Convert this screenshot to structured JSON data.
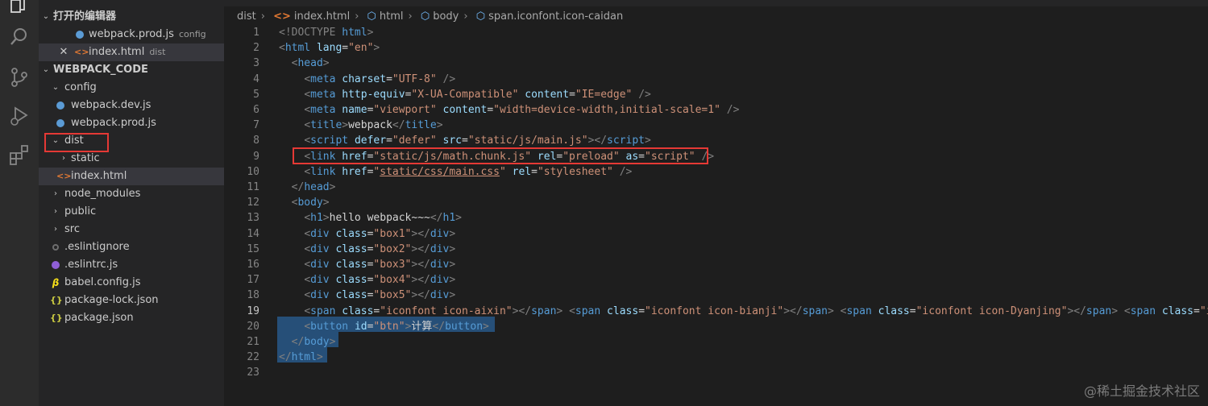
{
  "activity": {
    "icons": [
      "explorer-icon",
      "search-icon",
      "source-control-icon",
      "run-debug-icon",
      "extensions-icon"
    ]
  },
  "sidebar": {
    "open_editors_title": "打开的编辑器",
    "open_editors": [
      {
        "name": "webpack.prod.js",
        "desc": "config"
      },
      {
        "name": "index.html",
        "desc": "dist",
        "close": "✕"
      }
    ],
    "workspace_title": "WEBPACK_CODE",
    "tree": {
      "config": "config",
      "dev": "webpack.dev.js",
      "prod": "webpack.prod.js",
      "dist": "dist",
      "static": "static",
      "index": "index.html",
      "node_modules": "node_modules",
      "public": "public",
      "src": "src",
      "eslintignore": ".eslintignore",
      "eslintrc": ".eslintrc.js",
      "babel": "babel.config.js",
      "pkglock": "package-lock.json",
      "pkg": "package.json"
    }
  },
  "breadcrumb": {
    "dist": "dist",
    "index": "index.html",
    "html": "html",
    "body": "body",
    "span": "span.iconfont.icon-caidan"
  },
  "editor": {
    "line_numbers": [
      "1",
      "2",
      "3",
      "4",
      "5",
      "6",
      "7",
      "8",
      "9",
      "10",
      "11",
      "12",
      "13",
      "14",
      "15",
      "16",
      "17",
      "18",
      "19",
      "20",
      "21",
      "22",
      "23"
    ],
    "lines": [
      [
        [
          "t-pun",
          "<!DOCTYPE "
        ],
        [
          "t-tag",
          "html"
        ],
        [
          "t-pun",
          ">"
        ]
      ],
      [
        [
          "t-pun",
          "<"
        ],
        [
          "t-tag",
          "html "
        ],
        [
          "t-attr",
          "lang"
        ],
        [
          "t-txt",
          "="
        ],
        [
          "t-str",
          "\"en\""
        ],
        [
          "t-pun",
          ">"
        ]
      ],
      [
        [
          "t-txt",
          "  "
        ],
        [
          "t-pun",
          "<"
        ],
        [
          "t-tag",
          "head"
        ],
        [
          "t-pun",
          ">"
        ]
      ],
      [
        [
          "t-txt",
          "    "
        ],
        [
          "t-pun",
          "<"
        ],
        [
          "t-tag",
          "meta "
        ],
        [
          "t-attr",
          "charset"
        ],
        [
          "t-txt",
          "="
        ],
        [
          "t-str",
          "\"UTF-8\""
        ],
        [
          "t-txt",
          " "
        ],
        [
          "t-pun",
          "/>"
        ]
      ],
      [
        [
          "t-txt",
          "    "
        ],
        [
          "t-pun",
          "<"
        ],
        [
          "t-tag",
          "meta "
        ],
        [
          "t-attr",
          "http-equiv"
        ],
        [
          "t-txt",
          "="
        ],
        [
          "t-str",
          "\"X-UA-Compatible\""
        ],
        [
          "t-txt",
          " "
        ],
        [
          "t-attr",
          "content"
        ],
        [
          "t-txt",
          "="
        ],
        [
          "t-str",
          "\"IE=edge\""
        ],
        [
          "t-txt",
          " "
        ],
        [
          "t-pun",
          "/>"
        ]
      ],
      [
        [
          "t-txt",
          "    "
        ],
        [
          "t-pun",
          "<"
        ],
        [
          "t-tag",
          "meta "
        ],
        [
          "t-attr",
          "name"
        ],
        [
          "t-txt",
          "="
        ],
        [
          "t-str",
          "\"viewport\""
        ],
        [
          "t-txt",
          " "
        ],
        [
          "t-attr",
          "content"
        ],
        [
          "t-txt",
          "="
        ],
        [
          "t-str",
          "\"width=device-width,initial-scale=1\""
        ],
        [
          "t-txt",
          " "
        ],
        [
          "t-pun",
          "/>"
        ]
      ],
      [
        [
          "t-txt",
          "    "
        ],
        [
          "t-pun",
          "<"
        ],
        [
          "t-tag",
          "title"
        ],
        [
          "t-pun",
          ">"
        ],
        [
          "t-txt",
          "webpack"
        ],
        [
          "t-pun",
          "</"
        ],
        [
          "t-tag",
          "title"
        ],
        [
          "t-pun",
          ">"
        ]
      ],
      [
        [
          "t-txt",
          "    "
        ],
        [
          "t-pun",
          "<"
        ],
        [
          "t-tag",
          "script "
        ],
        [
          "t-attr",
          "defer"
        ],
        [
          "t-txt",
          "="
        ],
        [
          "t-str",
          "\"defer\""
        ],
        [
          "t-txt",
          " "
        ],
        [
          "t-attr",
          "src"
        ],
        [
          "t-txt",
          "="
        ],
        [
          "t-str",
          "\"static/js/main.js\""
        ],
        [
          "t-pun",
          "></"
        ],
        [
          "t-tag",
          "script"
        ],
        [
          "t-pun",
          ">"
        ]
      ],
      [
        [
          "t-txt",
          "    "
        ],
        [
          "t-pun",
          "<"
        ],
        [
          "t-tag",
          "link "
        ],
        [
          "t-attr",
          "href"
        ],
        [
          "t-txt",
          "="
        ],
        [
          "t-str",
          "\"static/js/math.chunk.js\""
        ],
        [
          "t-txt",
          " "
        ],
        [
          "t-attr",
          "rel"
        ],
        [
          "t-txt",
          "="
        ],
        [
          "t-str",
          "\"preload\""
        ],
        [
          "t-txt",
          " "
        ],
        [
          "t-attr",
          "as"
        ],
        [
          "t-txt",
          "="
        ],
        [
          "t-str",
          "\"script\""
        ],
        [
          "t-txt",
          " "
        ],
        [
          "t-pun",
          "/>"
        ]
      ],
      [
        [
          "t-txt",
          "    "
        ],
        [
          "t-pun",
          "<"
        ],
        [
          "t-tag",
          "link "
        ],
        [
          "t-attr",
          "href"
        ],
        [
          "t-txt",
          "="
        ],
        [
          "t-str",
          "\""
        ],
        [
          "t-link",
          "static/css/main.css"
        ],
        [
          "t-str",
          "\""
        ],
        [
          "t-txt",
          " "
        ],
        [
          "t-attr",
          "rel"
        ],
        [
          "t-txt",
          "="
        ],
        [
          "t-str",
          "\"stylesheet\""
        ],
        [
          "t-txt",
          " "
        ],
        [
          "t-pun",
          "/>"
        ]
      ],
      [
        [
          "t-txt",
          "  "
        ],
        [
          "t-pun",
          "</"
        ],
        [
          "t-tag",
          "head"
        ],
        [
          "t-pun",
          ">"
        ]
      ],
      [
        [
          "t-txt",
          "  "
        ],
        [
          "t-pun",
          "<"
        ],
        [
          "t-tag",
          "body"
        ],
        [
          "t-pun",
          ">"
        ]
      ],
      [
        [
          "t-txt",
          "    "
        ],
        [
          "t-pun",
          "<"
        ],
        [
          "t-tag",
          "h1"
        ],
        [
          "t-pun",
          ">"
        ],
        [
          "t-txt",
          "hello webpack~~~"
        ],
        [
          "t-pun",
          "</"
        ],
        [
          "t-tag",
          "h1"
        ],
        [
          "t-pun",
          ">"
        ]
      ],
      [
        [
          "t-txt",
          "    "
        ],
        [
          "t-pun",
          "<"
        ],
        [
          "t-tag",
          "div "
        ],
        [
          "t-attr",
          "class"
        ],
        [
          "t-txt",
          "="
        ],
        [
          "t-str",
          "\"box1\""
        ],
        [
          "t-pun",
          "></"
        ],
        [
          "t-tag",
          "div"
        ],
        [
          "t-pun",
          ">"
        ]
      ],
      [
        [
          "t-txt",
          "    "
        ],
        [
          "t-pun",
          "<"
        ],
        [
          "t-tag",
          "div "
        ],
        [
          "t-attr",
          "class"
        ],
        [
          "t-txt",
          "="
        ],
        [
          "t-str",
          "\"box2\""
        ],
        [
          "t-pun",
          "></"
        ],
        [
          "t-tag",
          "div"
        ],
        [
          "t-pun",
          ">"
        ]
      ],
      [
        [
          "t-txt",
          "    "
        ],
        [
          "t-pun",
          "<"
        ],
        [
          "t-tag",
          "div "
        ],
        [
          "t-attr",
          "class"
        ],
        [
          "t-txt",
          "="
        ],
        [
          "t-str",
          "\"box3\""
        ],
        [
          "t-pun",
          "></"
        ],
        [
          "t-tag",
          "div"
        ],
        [
          "t-pun",
          ">"
        ]
      ],
      [
        [
          "t-txt",
          "    "
        ],
        [
          "t-pun",
          "<"
        ],
        [
          "t-tag",
          "div "
        ],
        [
          "t-attr",
          "class"
        ],
        [
          "t-txt",
          "="
        ],
        [
          "t-str",
          "\"box4\""
        ],
        [
          "t-pun",
          "></"
        ],
        [
          "t-tag",
          "div"
        ],
        [
          "t-pun",
          ">"
        ]
      ],
      [
        [
          "t-txt",
          "    "
        ],
        [
          "t-pun",
          "<"
        ],
        [
          "t-tag",
          "div "
        ],
        [
          "t-attr",
          "class"
        ],
        [
          "t-txt",
          "="
        ],
        [
          "t-str",
          "\"box5\""
        ],
        [
          "t-pun",
          "></"
        ],
        [
          "t-tag",
          "div"
        ],
        [
          "t-pun",
          ">"
        ]
      ],
      [
        [
          "t-txt",
          "    "
        ],
        [
          "t-pun",
          "<"
        ],
        [
          "t-tag",
          "span "
        ],
        [
          "t-attr",
          "class"
        ],
        [
          "t-txt",
          "="
        ],
        [
          "t-str",
          "\"iconfont icon-aixin\""
        ],
        [
          "t-pun",
          "></"
        ],
        [
          "t-tag",
          "span"
        ],
        [
          "t-pun",
          ">"
        ],
        [
          "t-txt",
          " "
        ],
        [
          "t-pun",
          "<"
        ],
        [
          "t-tag",
          "span "
        ],
        [
          "t-attr",
          "class"
        ],
        [
          "t-txt",
          "="
        ],
        [
          "t-str",
          "\"iconfont icon-bianji\""
        ],
        [
          "t-pun",
          "></"
        ],
        [
          "t-tag",
          "span"
        ],
        [
          "t-pun",
          ">"
        ],
        [
          "t-txt",
          " "
        ],
        [
          "t-pun",
          "<"
        ],
        [
          "t-tag",
          "span "
        ],
        [
          "t-attr",
          "class"
        ],
        [
          "t-txt",
          "="
        ],
        [
          "t-str",
          "\"iconfont icon-Dyanjing\""
        ],
        [
          "t-pun",
          "></"
        ],
        [
          "t-tag",
          "span"
        ],
        [
          "t-pun",
          ">"
        ],
        [
          "t-txt",
          " "
        ],
        [
          "t-pun",
          "<"
        ],
        [
          "t-tag",
          "span "
        ],
        [
          "t-attr",
          "class"
        ],
        [
          "t-txt",
          "="
        ],
        [
          "t-str",
          "\"i"
        ]
      ],
      [
        [
          "t-txt",
          "    "
        ],
        [
          "t-pun",
          "<"
        ],
        [
          "t-tag",
          "button "
        ],
        [
          "t-attr",
          "id"
        ],
        [
          "t-txt",
          "="
        ],
        [
          "t-str",
          "\"btn\""
        ],
        [
          "t-pun",
          ">"
        ],
        [
          "t-txt",
          "计算"
        ],
        [
          "t-pun",
          "</"
        ],
        [
          "t-tag",
          "button"
        ],
        [
          "t-pun",
          ">"
        ]
      ],
      [
        [
          "t-txt",
          "  "
        ],
        [
          "t-pun",
          "</"
        ],
        [
          "t-tag",
          "body"
        ],
        [
          "t-pun",
          ">"
        ]
      ],
      [
        [
          "t-pun",
          "</"
        ],
        [
          "t-tag",
          "html"
        ],
        [
          "t-pun",
          ">"
        ]
      ],
      [
        [
          "t-txt",
          ""
        ]
      ]
    ]
  },
  "watermark": "@稀土掘金技术社区"
}
